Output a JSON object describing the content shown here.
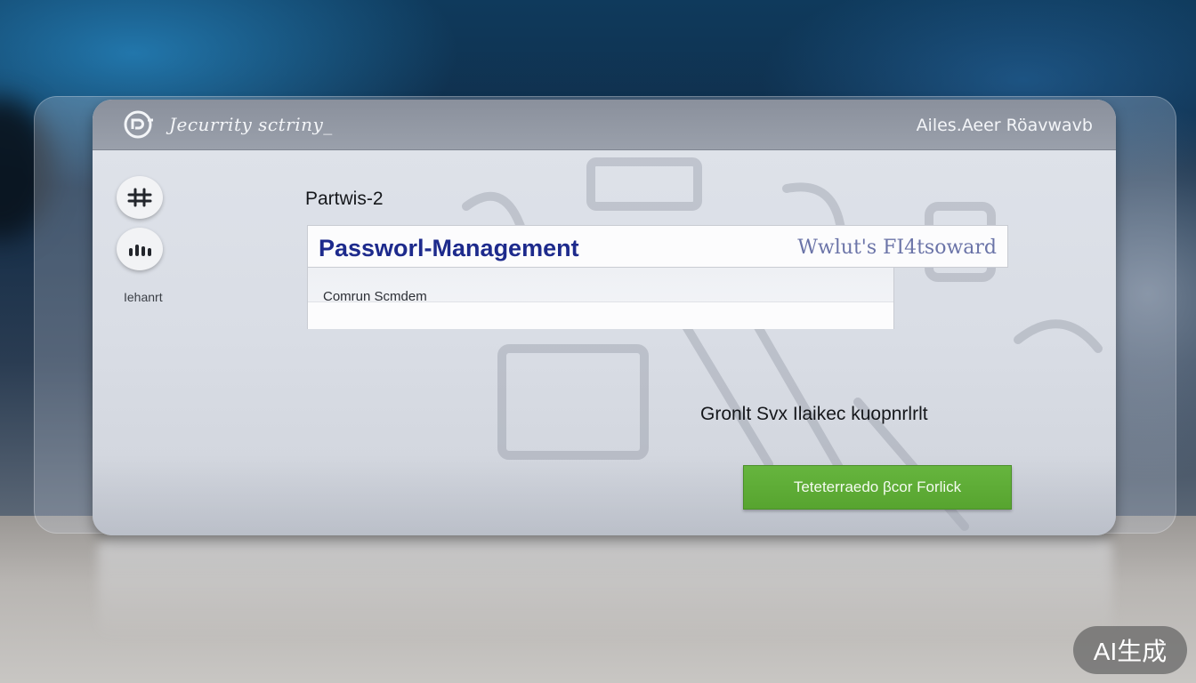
{
  "app": {
    "title": "Jecurrity sctriny_",
    "account_name": "Ailes.Aeer Röavwavb"
  },
  "sidebar": {
    "items": [
      {
        "icon": "hashtag-icon"
      },
      {
        "icon": "bars-icon"
      }
    ],
    "label": "Iehanrt"
  },
  "main": {
    "section_heading": "Partwis-2",
    "header": {
      "title": "Passworl-Management",
      "right_text": "Wwlut's FI4tsoward"
    },
    "field": {
      "label": "Comrun Scmdem",
      "value": ""
    },
    "status_text": "Gronlt Svx Ilaikec kuopnrlrlt",
    "action_button": "Teteterraedo βcor Forlick"
  },
  "watermark": "AI生成",
  "colors": {
    "title_bar": "#9097a3",
    "header_title": "#1d2a8c",
    "action_button": "#5faf36"
  }
}
